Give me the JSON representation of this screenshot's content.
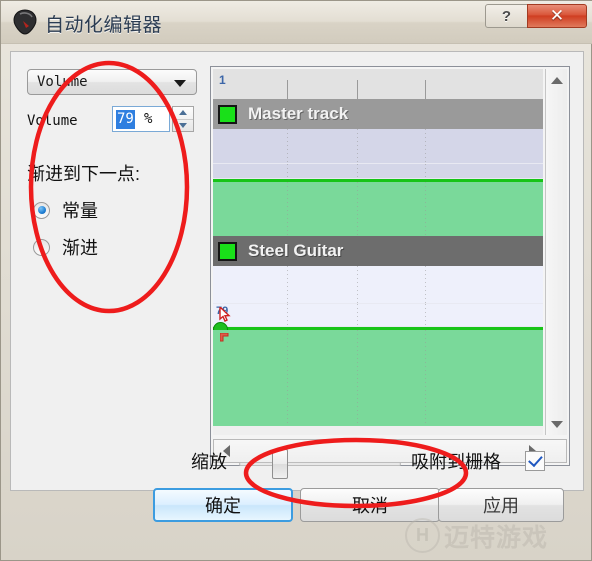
{
  "window": {
    "title": "自动化编辑器",
    "icon": "guitar-pick-icon",
    "help_label": "?",
    "close_label": "✕"
  },
  "left_panel": {
    "parameter_combo": {
      "value": "Volume",
      "arrow_icon": "chevron-down-icon"
    },
    "volume_field": {
      "label": "Volume",
      "value": "79",
      "unit": "%",
      "up_icon": "spinner-up-icon",
      "down_icon": "spinner-down-icon"
    },
    "fade_group": {
      "label": "渐进到下一点:",
      "options": [
        {
          "label": "常量",
          "selected": true
        },
        {
          "label": "渐进",
          "selected": false
        }
      ]
    }
  },
  "track_panel": {
    "ruler": {
      "measure": "1"
    },
    "tracks": [
      {
        "name": "Master track",
        "color": "#19e019"
      },
      {
        "name": "Steel Guitar",
        "color": "#19e019"
      }
    ],
    "automation_point": {
      "value": "79"
    },
    "vertical_scrollbar": {
      "up_icon": "scroll-up-icon",
      "down_icon": "scroll-down-icon"
    },
    "horizontal_scrollbar": {
      "left_icon": "scroll-left-icon",
      "right_icon": "scroll-right-icon"
    }
  },
  "bottom": {
    "zoom_label": "缩放",
    "snap_label": "吸附到栅格",
    "snap_checked": true,
    "check_icon": "checkmark-icon"
  },
  "buttons": {
    "ok": "确定",
    "cancel": "取消",
    "apply": "应用"
  },
  "watermark": {
    "logo": "H",
    "text": "迈特游戏"
  }
}
